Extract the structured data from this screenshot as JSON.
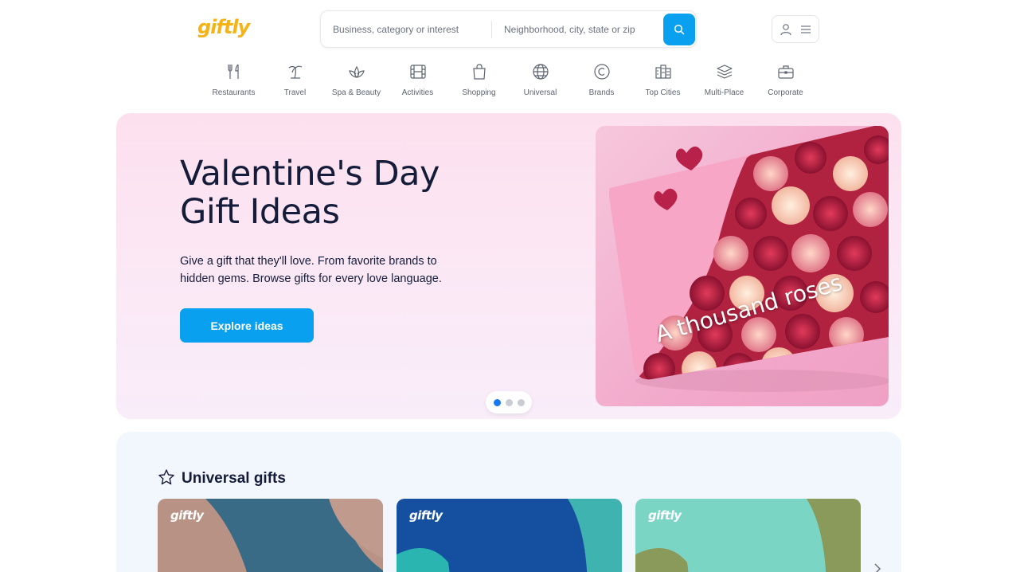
{
  "header": {
    "logo": "giftly",
    "search": {
      "what_placeholder": "Business, category or interest",
      "where_placeholder": "Neighborhood, city, state or zip"
    }
  },
  "categories": [
    {
      "label": "Restaurants",
      "icon": "utensils-icon"
    },
    {
      "label": "Travel",
      "icon": "palm-tree-icon"
    },
    {
      "label": "Spa & Beauty",
      "icon": "lotus-icon"
    },
    {
      "label": "Activities",
      "icon": "film-icon"
    },
    {
      "label": "Shopping",
      "icon": "shopping-bag-icon"
    },
    {
      "label": "Universal",
      "icon": "globe-icon"
    },
    {
      "label": "Brands",
      "icon": "copyright-icon"
    },
    {
      "label": "Top Cities",
      "icon": "buildings-icon"
    },
    {
      "label": "Multi-Place",
      "icon": "layers-icon"
    },
    {
      "label": "Corporate",
      "icon": "briefcase-icon"
    }
  ],
  "hero": {
    "title_line1": "Valentine's Day",
    "title_line2": "Gift Ideas",
    "description": "Give a gift that they'll love. From favorite brands to hidden gems. Browse gifts for every love language.",
    "cta": "Explore ideas",
    "image_caption": "A thousand roses",
    "slide_count": 3,
    "active_slide": 1
  },
  "universal_gifts": {
    "title": "Universal gifts",
    "cards": [
      {
        "logo": "giftly",
        "colors": [
          "#b89284",
          "#3a6b86",
          "#c09a8c"
        ]
      },
      {
        "logo": "giftly",
        "colors": [
          "#1550a0",
          "#3fb3b0",
          "#2ab5b0"
        ]
      },
      {
        "logo": "giftly",
        "colors": [
          "#7bd5c4",
          "#8a9a5b",
          "#8a9a5b"
        ]
      }
    ]
  },
  "colors": {
    "brand_yellow": "#f5b316",
    "accent_blue": "#0aa0f0",
    "hero_bg": "#fde0ee",
    "text_dark": "#141c3a"
  }
}
